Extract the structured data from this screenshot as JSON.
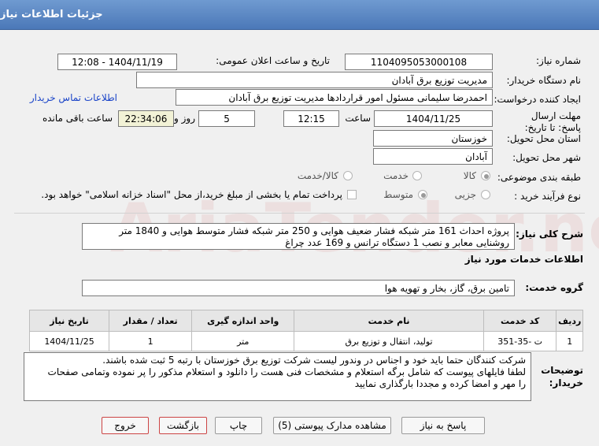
{
  "header": {
    "title": "جزئیات اطلاعات نیاز"
  },
  "fields": {
    "need_number_label": "شماره نیاز:",
    "need_number": "1104095053000108",
    "announce_label": "تاریخ و ساعت اعلان عمومی:",
    "announce_value": "1404/11/19 - 12:08",
    "buyer_org_label": "نام دستگاه خریدار:",
    "buyer_org": "مدیریت توزیع برق آبادان",
    "creator_label": "ایجاد کننده درخواست:",
    "creator": "احمدرضا سلیمانی مسئول امور قراردادها مدیریت توزیع برق آبادان",
    "contact_link": "اطلاعات تماس خریدار",
    "deadline_label": "مهلت ارسال پاسخ: تا تاریخ:",
    "deadline_date": "1404/11/25",
    "time_label": "ساعت",
    "deadline_time": "12:15",
    "days_value": "5",
    "days_label": "روز و",
    "remaining_time": "22:34:06",
    "remaining_label": "ساعت باقی مانده",
    "province_label": "استان محل تحویل:",
    "province": "خوزستان",
    "city_label": "شهر محل تحویل:",
    "city": "آبادان",
    "category_label": "طبقه بندی موضوعی:",
    "category_options": [
      "کالا",
      "خدمت",
      "کالا/خدمت"
    ],
    "process_label": "نوع فرآیند خرید :",
    "process_options": [
      "جزیی",
      "متوسط"
    ],
    "payment_note": "پرداخت تمام یا بخشی از مبلغ خرید،از محل \"اسناد خزانه اسلامی\" خواهد بود."
  },
  "description": {
    "label": "شرح کلی نیاز:",
    "text": "پروژه احداث 161 متر شبکه فشار ضعیف هوایی و 250 متر شبکه فشار متوسط هوایی و 1840 متر روشنایی معابر و نصب 1 دستگاه ترانس و 169 عدد چراغ"
  },
  "services": {
    "section_title": "اطلاعات خدمات مورد نیاز",
    "group_label": "گروه خدمت:",
    "group_value": "تامین برق، گاز، بخار و تهویه هوا",
    "table": {
      "headers": [
        "ردیف",
        "کد خدمت",
        "نام خدمت",
        "واحد اندازه گیری",
        "تعداد / مقدار",
        "تاریخ نیاز"
      ],
      "rows": [
        [
          "1",
          "ت -35-351",
          "تولید، انتقال و توزیع برق",
          "متر",
          "1",
          "1404/11/25"
        ]
      ]
    }
  },
  "notes": {
    "label": "توضیحات خریدار:",
    "lines": [
      "شرکت کنندگان حتما باید خود و اجناس در وندور لیست شرکت توزیع برق خوزستان با رتبه 5 ثبت شده باشند.",
      "لطفا فایلهای پیوست که شامل برگه استعلام و مشخصات فنی هست را دانلود و استعلام مذکور را پر نموده وتمامی صفحات",
      "را مهر و امضا کرده و مجددا بارگذاری نمایید"
    ]
  },
  "buttons": {
    "reply": "پاسخ به نیاز",
    "attachments": "مشاهده مدارک پیوستی (5)",
    "print": "چاپ",
    "back": "بازگشت",
    "exit": "خروج"
  },
  "watermark": "AriaTender.neT",
  "colors": {
    "titlebar": "#5a86c2",
    "link": "#1a44c8",
    "danger": "#cc4444"
  }
}
